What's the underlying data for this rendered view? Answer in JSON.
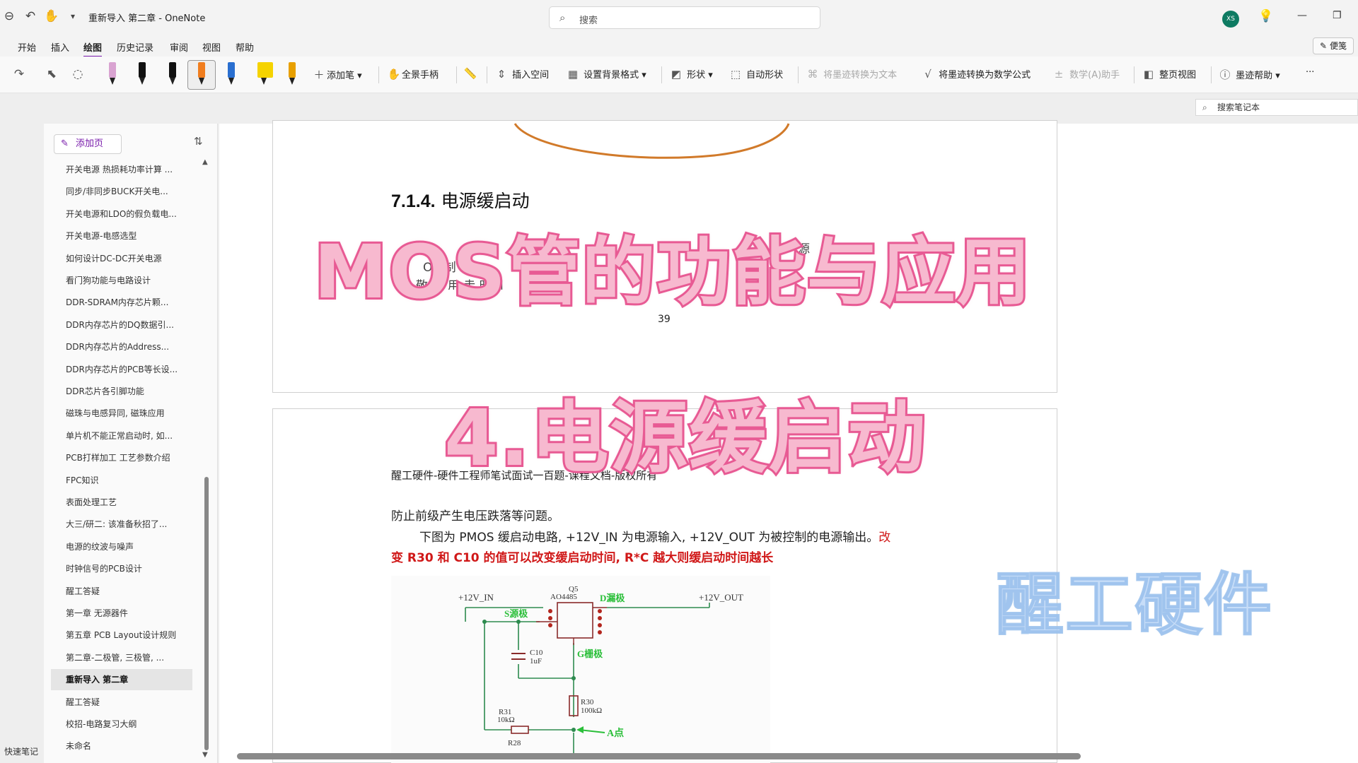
{
  "titlebar": {
    "title": "重新导入 第二章 - OneNote",
    "search_placeholder": "搜索",
    "avatar_initials": "XS"
  },
  "menu": {
    "items": [
      "开始",
      "插入",
      "绘图",
      "历史记录",
      "审阅",
      "视图",
      "帮助"
    ],
    "active": "绘图",
    "sticky_notes": "便笺"
  },
  "ribbon": {
    "add_pen": "添加笔",
    "full_hand": "全景手柄",
    "insert_space": "插入空间",
    "background_format": "设置背景格式",
    "shapes": "形状",
    "auto_shapes": "自动形状",
    "ink_to_text": "将墨迹转换为文本",
    "ink_to_math": "将墨迹转换为数学公式",
    "math_assistant": "数学(A)助手",
    "page_view": "整页视图",
    "ink_help": "墨迹帮助",
    "more": "···",
    "pen_colors": [
      "#d9a3d1",
      "#111111",
      "#111111",
      "#f07d1e",
      "#2a6fd0",
      "#f5d300",
      "#e8a000"
    ]
  },
  "notebook_search": "搜索笔记本",
  "pages": {
    "add_page": "添加页",
    "items": [
      "开关电源 热损耗功率计算 ...",
      "同步/非同步BUCK开关电...",
      "开关电源和LDO的假负载电...",
      "开关电源-电感选型",
      "如何设计DC-DC开关电源",
      "看门狗功能与电路设计",
      "DDR-SDRAM内存芯片颗...",
      "DDR内存芯片的DQ数据引...",
      "DDR内存芯片的Address...",
      "DDR内存芯片的PCB等长设...",
      "DDR芯片各引脚功能",
      "磁珠与电感异同, 磁珠应用",
      "单片机不能正常启动时, 如...",
      "PCB打样加工 工艺参数介绍",
      "FPC知识",
      "表面处理工艺",
      "大三/研二: 该准备秋招了...",
      "电源的纹波与噪声",
      "时钟信号的PCB设计",
      "醒工答疑",
      "第一章 无源器件",
      "第五章 PCB Layout设计规则",
      "第二章-二极管, 三极管, ...",
      "重新导入 第二章",
      "醒工答疑",
      "校招-电路复习大纲",
      "未命名"
    ],
    "selected_index": 23,
    "quick_notes": "快速笔记"
  },
  "document": {
    "heading_number": "7.1.4.",
    "heading_text": "电源缓启动",
    "partial_line1": "源",
    "partial_line2": "OS 制",
    "partial_line3": "敬 制 用 走 时间",
    "page_number": "39",
    "doc_header": "醒工硬件-硬件工程师笔试面试一百题-课程文档-版权所有",
    "para1": "防止前级产生电压跌落等问题。",
    "para2_normal": "下图为 PMOS 缓启动电路, +12V_IN 为电源输入, +12V_OUT 为被控制的电源输出。",
    "para2_red": "改",
    "para3": "变 R30 和 C10 的值可以改变缓启动时间, R*C 越大则缓启动时间越长"
  },
  "schematic": {
    "vin": "+12V_IN",
    "vout": "+12V_OUT",
    "q_ref": "Q5",
    "q_part": "AO4485",
    "source_label": "S源极",
    "drain_label": "D漏极",
    "gate_label": "G栅极",
    "c_ref": "C10",
    "c_val": "1uF",
    "r30_ref": "R30",
    "r30_val": "100kΩ",
    "r31_ref": "R31",
    "r31_val": "10kΩ",
    "r28_ref": "R28",
    "point_a": "A点",
    "label_color": "#2bbf3a"
  },
  "overlay": {
    "main_title": "MOS管的功能与应用",
    "sub_title": "4.电源缓启动",
    "watermark": "醒工硬件"
  }
}
